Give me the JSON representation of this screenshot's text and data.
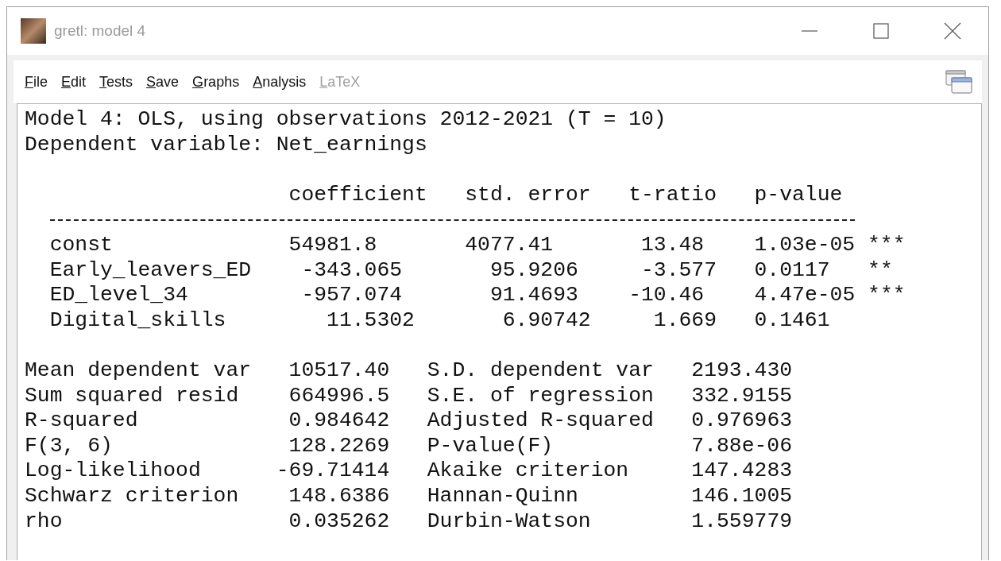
{
  "window": {
    "title": "gretl: model 4"
  },
  "menu": [
    {
      "label": "File",
      "disabled": false
    },
    {
      "label": "Edit",
      "disabled": false
    },
    {
      "label": "Tests",
      "disabled": false
    },
    {
      "label": "Save",
      "disabled": false
    },
    {
      "label": "Graphs",
      "disabled": false
    },
    {
      "label": "Analysis",
      "disabled": false
    },
    {
      "label": "LaTeX",
      "disabled": true
    }
  ],
  "output": {
    "header_lines": [
      "Model 4: OLS, using observations 2012-2021 (T = 10)",
      "Dependent variable: Net_earnings"
    ],
    "table": {
      "columns": [
        "coefficient",
        "std. error",
        "t-ratio",
        "p-value"
      ],
      "rows": [
        {
          "name": "const",
          "coefficient": "54981.8",
          "std_error": "4077.41",
          "t_ratio": "13.48",
          "p_value": "1.03e-05",
          "stars": "***"
        },
        {
          "name": "Early_leavers_ED",
          "coefficient": "-343.065",
          "std_error": "95.9206",
          "t_ratio": "-3.577",
          "p_value": "0.0117",
          "stars": "**"
        },
        {
          "name": "ED_level_34",
          "coefficient": "-957.074",
          "std_error": "91.4693",
          "t_ratio": "-10.46",
          "p_value": "4.47e-05",
          "stars": "***"
        },
        {
          "name": "Digital_skills",
          "coefficient": "11.5302",
          "std_error": "6.90742",
          "t_ratio": "1.669",
          "p_value": "0.1461"
        }
      ]
    },
    "stats": [
      {
        "label": "Mean dependent var",
        "value": "10517.40",
        "label_2": "S.D. dependent var",
        "value_2": "2193.430"
      },
      {
        "label": "Sum squared resid",
        "value": "664996.5",
        "label_2": "S.E. of regression",
        "value_2": "332.9155"
      },
      {
        "label": "R-squared",
        "value": "0.984642",
        "label_2": "Adjusted R-squared",
        "value_2": "0.976963"
      },
      {
        "label": "F(3, 6)",
        "value": "128.2269",
        "label_2": "P-value(F)",
        "value_2": "7.88e-06"
      },
      {
        "label": "Log-likelihood",
        "value": "-69.71414",
        "label_2": "Akaike criterion",
        "value_2": "147.4283"
      },
      {
        "label": "Schwarz criterion",
        "value": "148.6386",
        "label_2": "Hannan-Quinn",
        "value_2": "146.1005"
      },
      {
        "label": "rho",
        "value": "0.035262",
        "label_2": "Durbin-Watson",
        "value_2": "1.559779"
      }
    ]
  }
}
